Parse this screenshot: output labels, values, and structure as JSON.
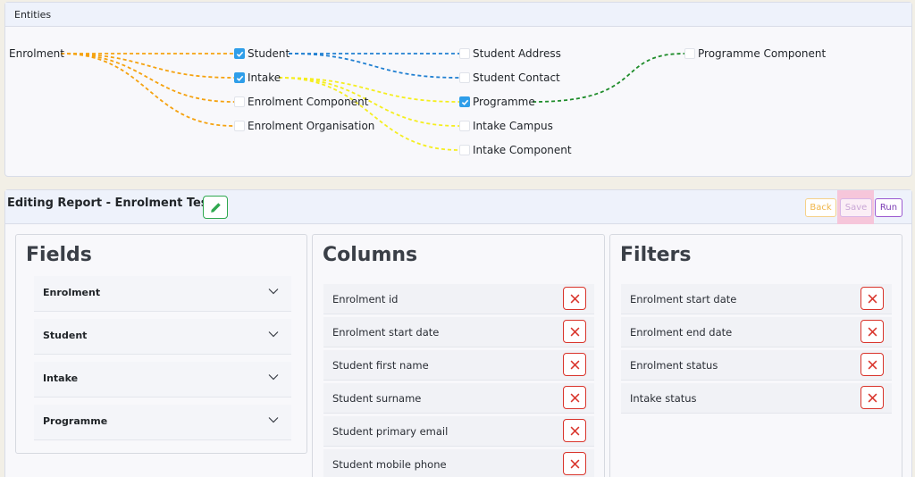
{
  "entities": {
    "title": "Entities",
    "nodes": {
      "enrolment": "Enrolment",
      "student": "Student",
      "intake": "Intake",
      "enrolment_component": "Enrolment Component",
      "enrolment_organisation": "Enrolment Organisation",
      "student_address": "Student Address",
      "student_contact": "Student Contact",
      "programme": "Programme",
      "intake_campus": "Intake Campus",
      "intake_component": "Intake Component",
      "programme_component": "Programme Component"
    },
    "checked": {
      "student": true,
      "intake": true,
      "programme": true,
      "enrolment_component": false,
      "enrolment_organisation": false,
      "student_address": false,
      "student_contact": false,
      "intake_campus": false,
      "intake_component": false,
      "programme_component": false
    },
    "link_colors": {
      "enrolment": "#f5a20f",
      "student": "#1f7fd1",
      "intake": "#f5ee1e",
      "programme": "#1e8c2a"
    }
  },
  "editor": {
    "title": "Editing Report - Enrolment Test",
    "buttons": {
      "back": "Back",
      "save": "Save",
      "run": "Run"
    }
  },
  "fields": {
    "title": "Fields",
    "groups": [
      "Enrolment",
      "Student",
      "Intake",
      "Programme"
    ]
  },
  "columns": {
    "title": "Columns",
    "items": [
      "Enrolment id",
      "Enrolment start date",
      "Student first name",
      "Student surname",
      "Student primary email",
      "Student mobile phone"
    ]
  },
  "filters": {
    "title": "Filters",
    "items": [
      "Enrolment start date",
      "Enrolment end date",
      "Enrolment status",
      "Intake status"
    ]
  },
  "colors": {
    "edit_green": "#2fa84f",
    "delete_red": "#d9342b",
    "checkbox_blue": "#2f9ee9",
    "back_orange": "#f0b64a",
    "run_purple": "#7a3cb4"
  }
}
